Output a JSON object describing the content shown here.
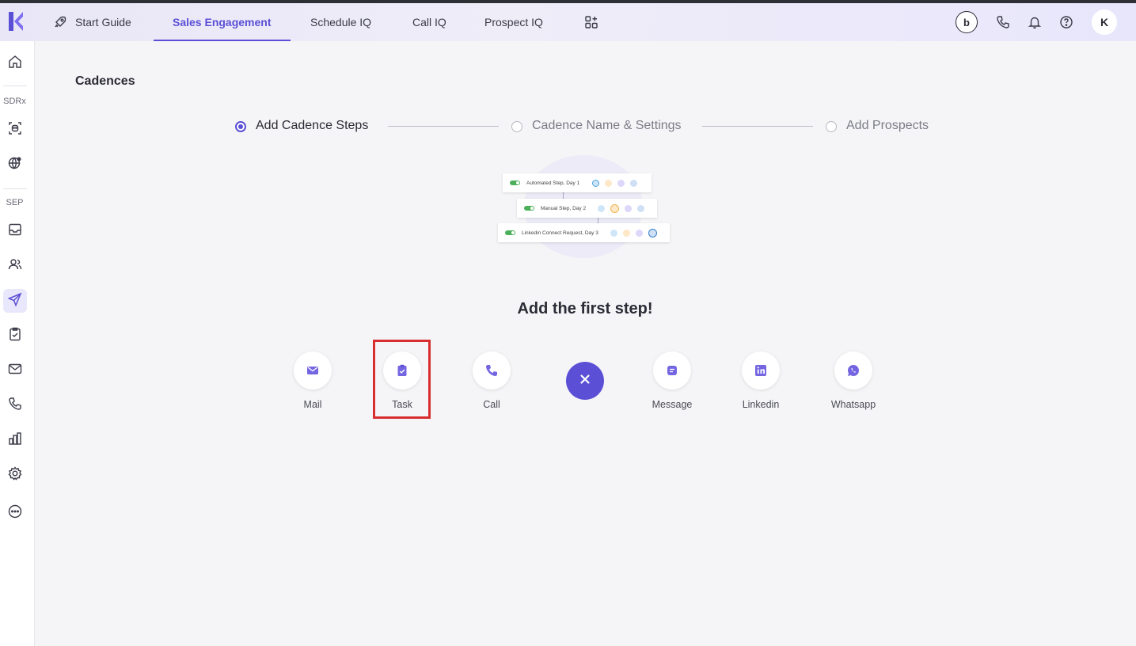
{
  "nav": {
    "tabs": [
      {
        "label": "Start Guide",
        "icon": "rocket-icon"
      },
      {
        "label": "Sales Engagement",
        "active": true
      },
      {
        "label": "Schedule IQ"
      },
      {
        "label": "Call IQ"
      },
      {
        "label": "Prospect IQ"
      }
    ],
    "avatar_initial": "K",
    "brand_glyph": "b"
  },
  "sidebar": {
    "section_sdrx": "SDRx",
    "section_sep": "SEP"
  },
  "page": {
    "title": "Cadences"
  },
  "stepper": {
    "steps": [
      {
        "label": "Add Cadence Steps",
        "state": "active"
      },
      {
        "label": "Cadence Name & Settings",
        "state": "inactive"
      },
      {
        "label": "Add Prospects",
        "state": "inactive"
      }
    ]
  },
  "illustration": {
    "cards": [
      {
        "label": "Automated Step, Day 1"
      },
      {
        "label": "Manual Step, Day 2"
      },
      {
        "label": "Linkedin Connect Request, Day 3"
      }
    ]
  },
  "main": {
    "heading": "Add the first step!",
    "channels": [
      {
        "label": "Mail",
        "icon": "mail-icon"
      },
      {
        "label": "Task",
        "icon": "clipboard-check-icon"
      },
      {
        "label": "Call",
        "icon": "phone-icon"
      },
      {
        "label": "Message",
        "icon": "message-icon"
      },
      {
        "label": "Linkedin",
        "icon": "linkedin-icon"
      },
      {
        "label": "Whatsapp",
        "icon": "whatsapp-icon"
      }
    ]
  },
  "colors": {
    "accent": "#5b4fd6",
    "highlight": "#d72f2f"
  }
}
